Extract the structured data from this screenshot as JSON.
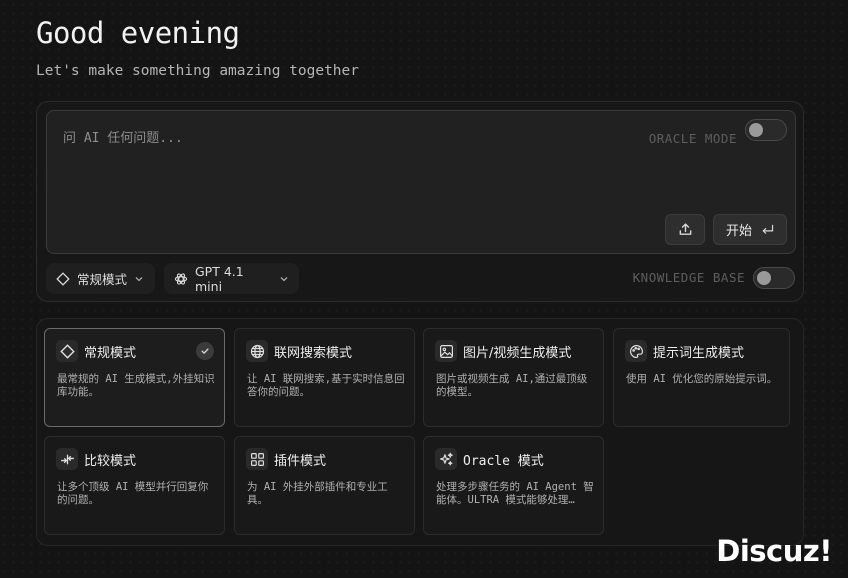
{
  "header": {
    "greeting": "Good evening",
    "subtitle": "Let's make something amazing together"
  },
  "prompt": {
    "placeholder": "问 AI 任何问题...",
    "value": "",
    "oracle_mode_label": "ORACLE MODE",
    "oracle_mode_on": false,
    "start_label": "开始",
    "upload_icon": "upload-icon",
    "enter_icon": "enter-key-icon"
  },
  "toolbar": {
    "mode_selector_label": "常规模式",
    "model_selector_label": "GPT 4.1 mini",
    "knowledge_base_label": "KNOWLEDGE BASE",
    "knowledge_base_on": false
  },
  "modes": [
    {
      "title": "常规模式",
      "description": "最常规的 AI 生成模式,外挂知识库功能。",
      "icon": "diamond-icon",
      "selected": true
    },
    {
      "title": "联网搜索模式",
      "description": "让 AI 联网搜索,基于实时信息回答你的问题。",
      "icon": "globe-icon",
      "selected": false
    },
    {
      "title": "图片/视频生成模式",
      "description": "图片或视频生成 AI,通过最顶级的模型。",
      "icon": "image-icon",
      "selected": false
    },
    {
      "title": "提示词生成模式",
      "description": "使用 AI 优化您的原始提示词。",
      "icon": "palette-icon",
      "selected": false
    },
    {
      "title": "比较模式",
      "description": "让多个顶级 AI 模型并行回复你的问题。",
      "icon": "compare-arrows-icon",
      "selected": false
    },
    {
      "title": "插件模式",
      "description": "为 AI 外挂外部插件和专业工具。",
      "icon": "grid-icon",
      "selected": false
    },
    {
      "title": "Oracle 模式",
      "description": "处理多步骤任务的 AI Agent 智能体。ULTRA 模式能够处理…",
      "icon": "sparkles-icon",
      "selected": false
    }
  ],
  "watermark": "Discuz!"
}
